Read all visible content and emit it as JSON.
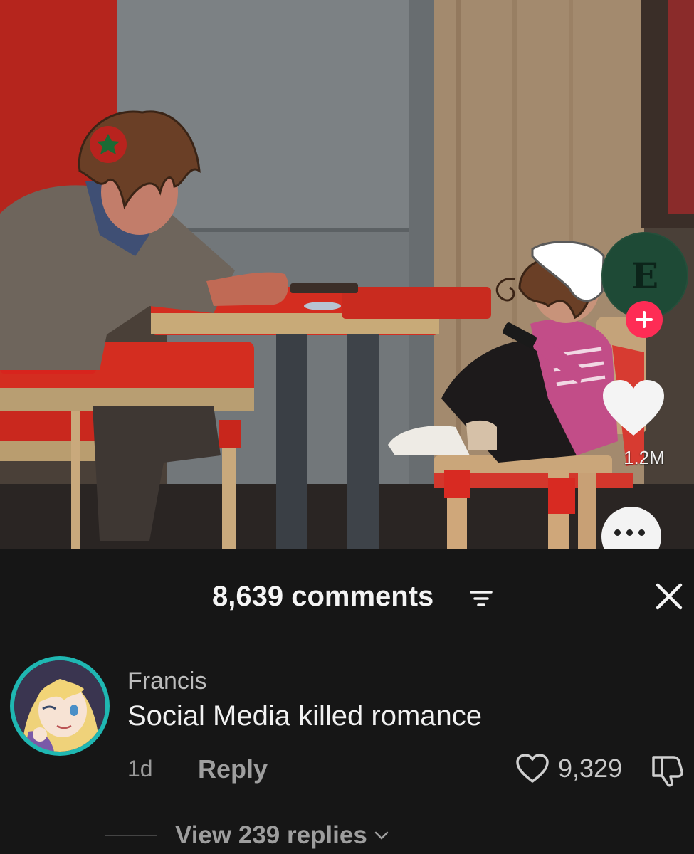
{
  "video": {
    "creator_avatar_letter": "E",
    "follow_icon": "plus-icon",
    "like_icon": "heart-icon",
    "like_count": "1.2M",
    "more_icon": "more-dots-icon",
    "colors": {
      "follow": "#fe2c55",
      "creator_avatar_bg": "#1e4a36"
    }
  },
  "comments": {
    "count_label": "8,639 comments",
    "filter_icon": "sort-filter-icon",
    "close_icon": "close-icon",
    "items": [
      {
        "username": "Francis",
        "text": "Social Media killed romance",
        "time": "1d",
        "reply_label": "Reply",
        "like_count": "9,329",
        "view_replies_label": "View 239 replies"
      }
    ]
  }
}
